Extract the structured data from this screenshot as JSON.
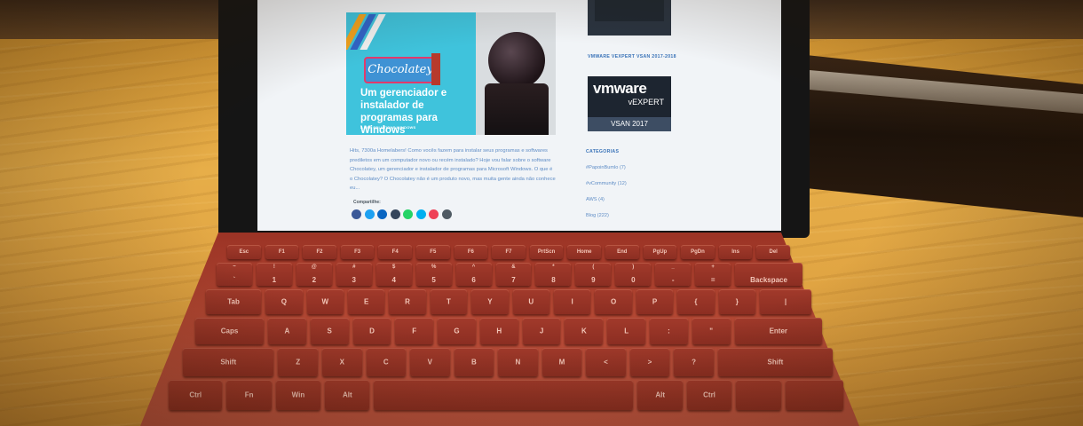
{
  "screen": {
    "article": {
      "image_brand": "Chocolatey",
      "image_title": "Um gerenciador e instalador de programas para Windows",
      "image_subtitle": "& APP SOLUTIONS WINDOWS",
      "excerpt": "Hits, 7300a Homelabers! Como vocês fazem para instalar seus programas e softwares prediletos em um computador novo ou recém instalado? Hoje vou falar sobre o software Chocolatey, um gerenciador e instalador de programas para Microsoft Windows. O que é o Chocolatey? O Chocolatey não é um produto novo, mas muita gente ainda não conhece eu...",
      "share_label": "Compartilhe:",
      "share_icons": [
        "facebook-icon",
        "twitter-icon",
        "linkedin-icon",
        "tumblr-icon",
        "whatsapp-icon",
        "skype-icon",
        "pocket-icon",
        "email-icon"
      ],
      "share_colors": [
        "#3b5998",
        "#1da1f2",
        "#0a66c2",
        "#35465c",
        "#25d366",
        "#00aff0",
        "#ef4056",
        "#4f5a63"
      ]
    },
    "sidebar": {
      "heading_vsan": "VMWARE VEXPERT VSAN 2017-2018",
      "vexpert_logo": "vmware",
      "vexpert_label": "vEXPERT",
      "vexpert_year": "VSAN 2017",
      "categories_heading": "CATEGORIAS",
      "categories": [
        "#PapoinBumlo (7)",
        "#vCommunity (12)",
        "AWS (4)",
        "Blog (222)"
      ]
    }
  },
  "keyboard": {
    "row0": [
      "Esc",
      "F1",
      "F2",
      "F3",
      "F4",
      "F5",
      "F6",
      "F7",
      "PrtScn",
      "Home",
      "End",
      "PgUp",
      "PgDn",
      "Ins",
      "Del"
    ],
    "row1_top": [
      "~",
      "!",
      "@",
      "#",
      "$",
      "%",
      "^",
      "&",
      "*",
      "(",
      ")",
      "_",
      "+",
      ""
    ],
    "row1_bot": [
      "`",
      "1",
      "2",
      "3",
      "4",
      "5",
      "6",
      "7",
      "8",
      "9",
      "0",
      "-",
      "=",
      "Backspace"
    ],
    "row2": [
      "Tab",
      "Q",
      "W",
      "E",
      "R",
      "T",
      "Y",
      "U",
      "I",
      "O",
      "P",
      "{",
      "}",
      "|"
    ],
    "row3": [
      "Caps",
      "A",
      "S",
      "D",
      "F",
      "G",
      "H",
      "J",
      "K",
      "L",
      ":",
      "\"",
      "Enter"
    ],
    "row4": [
      "Shift",
      "Z",
      "X",
      "C",
      "V",
      "B",
      "N",
      "M",
      "<",
      ">",
      "?",
      "Shift"
    ],
    "row5": [
      "Ctrl",
      "Fn",
      "Win",
      "Alt",
      "",
      "Alt",
      "Ctrl",
      "",
      ""
    ]
  }
}
